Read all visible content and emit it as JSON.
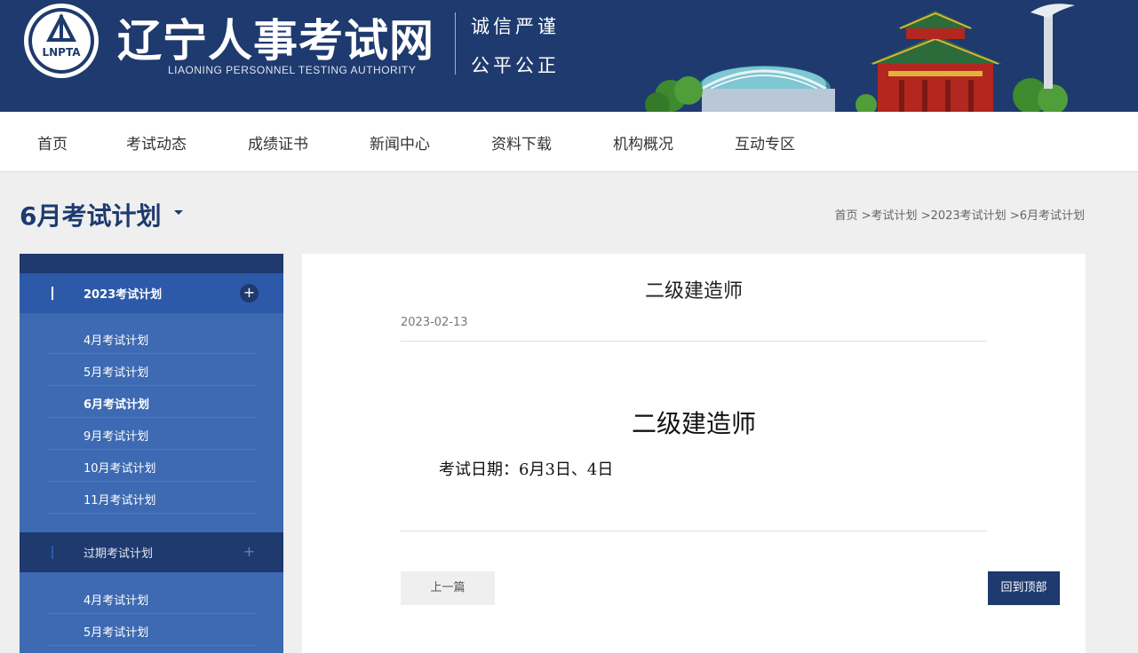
{
  "header": {
    "logo_text": "LNPTA",
    "site_title": "辽宁人事考试网",
    "site_subtitle": "LIAONING PERSONNEL TESTING AUTHORITY",
    "motto_line1": "诚信严谨",
    "motto_line2": "公平公正",
    "brand_color": "#1e3a6e"
  },
  "nav": {
    "items": [
      {
        "label": "首页"
      },
      {
        "label": "考试动态"
      },
      {
        "label": "成绩证书"
      },
      {
        "label": "新闻中心"
      },
      {
        "label": "资料下载"
      },
      {
        "label": "机构概况"
      },
      {
        "label": "互动专区"
      }
    ]
  },
  "page": {
    "title": "6月考试计划",
    "breadcrumb": [
      "首页",
      ">考试计划",
      ">2023考试计划",
      ">6月考试计划"
    ]
  },
  "sidebar": {
    "group1": {
      "label": "2023考试计划",
      "toggle": "+",
      "items": [
        {
          "label": "4月考试计划"
        },
        {
          "label": "5月考试计划"
        },
        {
          "label": "6月考试计划"
        },
        {
          "label": "9月考试计划"
        },
        {
          "label": "10月考试计划"
        },
        {
          "label": "11月考试计划"
        }
      ],
      "active": "6月考试计划"
    },
    "group2": {
      "label": "过期考试计划",
      "toggle": "+",
      "items": [
        {
          "label": "4月考试计划"
        },
        {
          "label": "5月考试计划"
        }
      ]
    }
  },
  "article": {
    "title": "二级建造师",
    "date": "2023-02-13",
    "body_title": "二级建造师",
    "body_line": "考试日期：6月3日、4日",
    "prev_label": "上一篇",
    "top_label": "回到顶部"
  }
}
